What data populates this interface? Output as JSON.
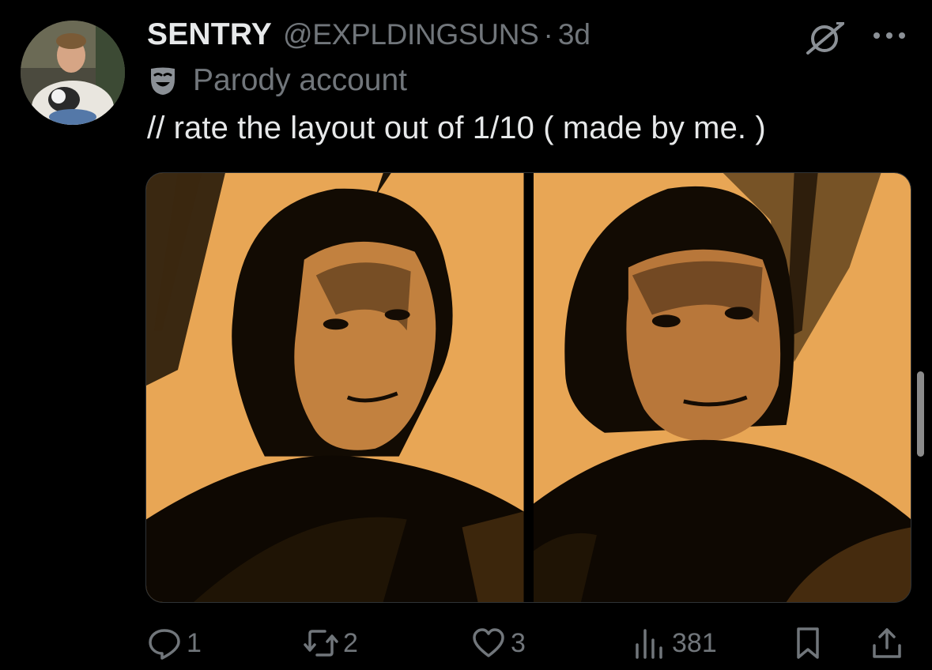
{
  "author": {
    "name": "SENTRY",
    "handle": "@EXPLDINGSUNS",
    "separator": "·",
    "time": "3d"
  },
  "badge": {
    "icon": "mask-icon",
    "label": "Parody account"
  },
  "tweet": {
    "text": "// rate the layout out of 1/10 ( made by me. )"
  },
  "media": {
    "images": [
      {
        "icon": "portrait-image"
      },
      {
        "icon": "portrait-image"
      }
    ],
    "tint_color": "#e8a655"
  },
  "actions": {
    "replies": "1",
    "reposts": "2",
    "likes": "3",
    "views": "381"
  },
  "colors": {
    "background": "#000000",
    "primary_text": "#e7e9ea",
    "secondary_text": "#71767b"
  }
}
